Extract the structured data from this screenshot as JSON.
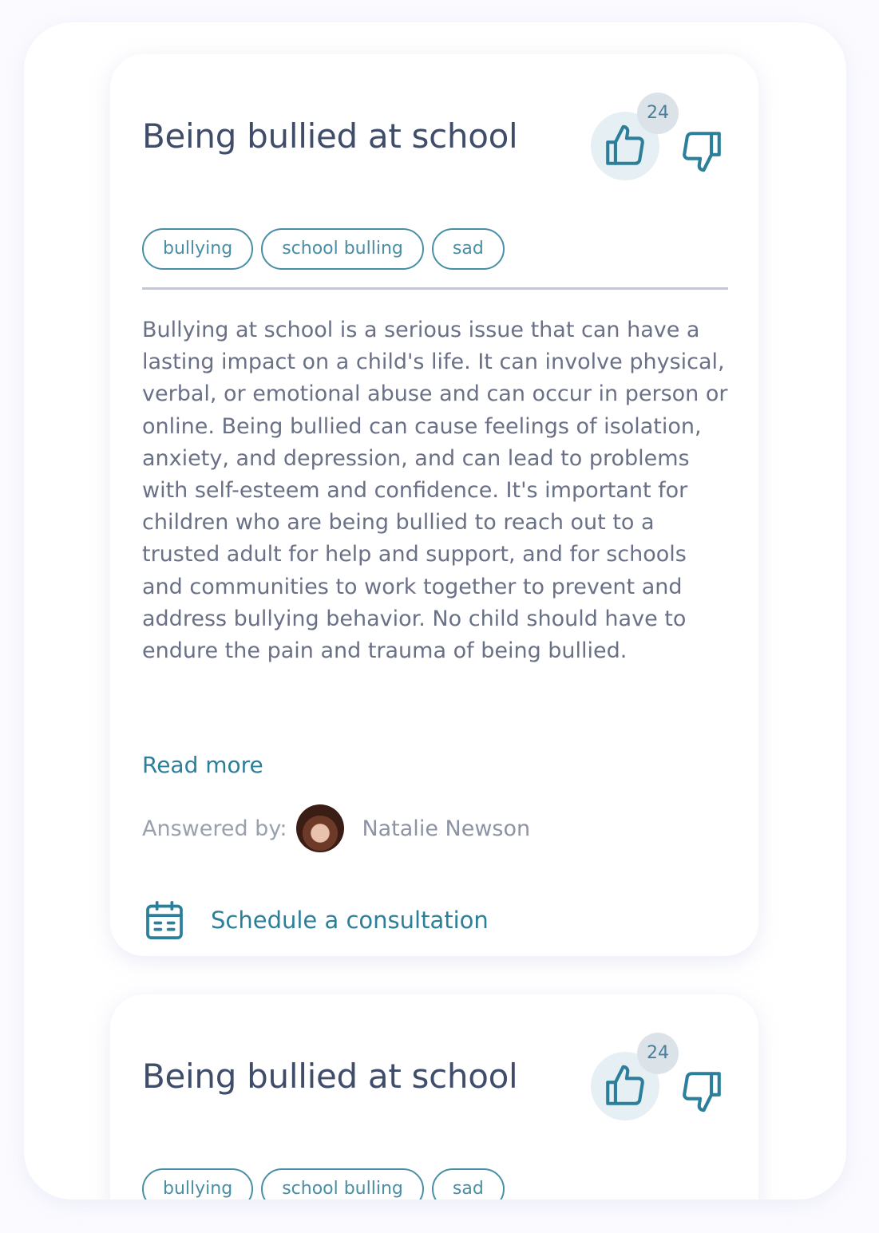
{
  "colors": {
    "accent": "#2c7f9a",
    "tag_border": "#4a8ea6",
    "title": "#3f4c6a",
    "body_text": "#6a7187",
    "like_bg": "#e6eff3",
    "badge_bg": "#dbe3e9"
  },
  "cards": [
    {
      "title": "Being bullied at school",
      "like_count": "24",
      "tags": [
        "bullying",
        "school bulling",
        "sad"
      ],
      "body": "Bullying at school is a serious issue that can have a lasting impact on a child's life. It can involve physical, verbal, or emotional abuse and can occur in person or online. Being bullied can cause feelings of isolation, anxiety, and depression, and can lead to problems with self-esteem and confidence. It's important for children who are being bullied to reach out to a trusted adult for help and support, and for schools and communities to work together to prevent and address bullying behavior. No child should have to endure the pain and trauma of being bullied.",
      "read_more": "Read more",
      "answered_label": "Answered by:",
      "answerer": "Natalie Newson",
      "schedule_label": "Schedule a consultation",
      "icons": [
        "thumbs-up-icon",
        "thumbs-down-icon",
        "calendar-icon"
      ]
    },
    {
      "title": "Being bullied at school",
      "like_count": "24",
      "tags": [
        "bullying",
        "school bulling",
        "sad"
      ]
    }
  ]
}
